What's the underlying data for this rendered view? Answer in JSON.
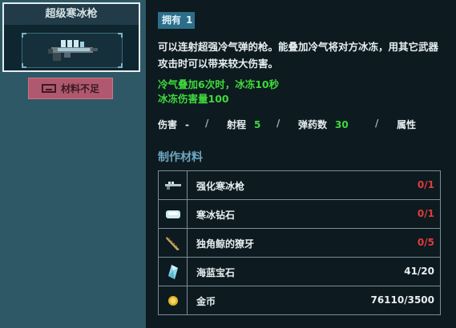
{
  "weapon": {
    "name": "超级寒冰枪"
  },
  "craft_button": {
    "label": "材料不足"
  },
  "detail": {
    "owned_label": "拥有",
    "owned_count": "1",
    "description": "可以连射超强冷气弹的枪。能叠加冷气将对方冰冻，用其它武器攻击时可以带来较大伤害。",
    "effects": [
      "冷气叠加6次时，冰冻10秒",
      "冰冻伤害量100"
    ],
    "stats": {
      "damage_label": "伤害",
      "damage_value": "-",
      "range_label": "射程",
      "range_value": "5",
      "ammo_label": "弹药数",
      "ammo_value": "30",
      "attribute_label": "属性",
      "separator": "/"
    }
  },
  "materials": {
    "title": "制作材料",
    "items": [
      {
        "name": "强化寒冰枪",
        "count": "0/1",
        "status": "insufficient",
        "icon": "ice-gun-icon"
      },
      {
        "name": "寒冰钻石",
        "count": "0/1",
        "status": "insufficient",
        "icon": "ice-diamond-icon"
      },
      {
        "name": "独角鲸的獠牙",
        "count": "0/5",
        "status": "insufficient",
        "icon": "narwhal-tusk-icon"
      },
      {
        "name": "海蓝宝石",
        "count": "41/20",
        "status": "sufficient",
        "icon": "aquamarine-icon"
      },
      {
        "name": "金币",
        "count": "76110/3500",
        "status": "sufficient",
        "icon": "gold-coin-icon"
      }
    ]
  },
  "colors": {
    "background": "#2e5866",
    "panel": "#0d1a20",
    "accent_green": "#3fd93a",
    "accent_red": "#e03b3b",
    "button": "#b0586e"
  }
}
